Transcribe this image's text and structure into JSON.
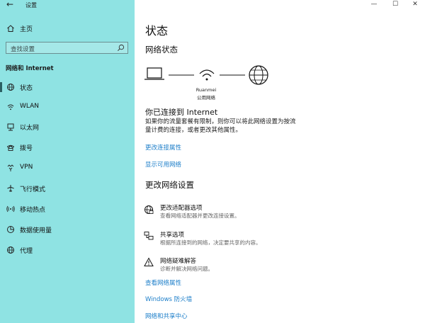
{
  "window": {
    "title": "设置",
    "back_icon": "←",
    "minimize_icon": "—",
    "maximize_icon": "☐",
    "close_icon": "✕"
  },
  "sidebar": {
    "home_label": "主页",
    "search_placeholder": "查找设置",
    "section_title": "网络和 Internet",
    "items": [
      {
        "label": "状态",
        "icon": "globe-icon"
      },
      {
        "label": "WLAN",
        "icon": "wifi-icon"
      },
      {
        "label": "以太网",
        "icon": "ethernet-icon"
      },
      {
        "label": "拨号",
        "icon": "dialup-icon"
      },
      {
        "label": "VPN",
        "icon": "vpn-icon"
      },
      {
        "label": "飞行模式",
        "icon": "airplane-icon"
      },
      {
        "label": "移动热点",
        "icon": "hotspot-icon"
      },
      {
        "label": "数据使用量",
        "icon": "data-usage-icon"
      },
      {
        "label": "代理",
        "icon": "globe-icon"
      }
    ],
    "active_index": 0
  },
  "main": {
    "title": "状态",
    "network_status_heading": "网络状态",
    "network_name": "Ruanmei",
    "network_type": "公用网络",
    "connected_heading": "你已连接到 Internet",
    "connected_desc": "如果你的流量套餐有限制，则你可以将此网络设置为按流量计费的连接，或者更改其他属性。",
    "links": {
      "change_props": "更改连接属性",
      "show_networks": "显示可用网络"
    },
    "change_settings_heading": "更改网络设置",
    "options": [
      {
        "title": "更改适配器选项",
        "desc": "查看网络适配器并更改连接设置。",
        "icon": "adapter-icon"
      },
      {
        "title": "共享选项",
        "desc": "根据所连接到的网络，决定要共享的内容。",
        "icon": "sharing-icon"
      },
      {
        "title": "网络疑难解答",
        "desc": "诊断并解决网络问题。",
        "icon": "warning-icon"
      }
    ],
    "bottom_links": {
      "view_properties": "查看网络属性",
      "firewall": "Windows 防火墙",
      "sharing_center": "网络和共享中心"
    }
  },
  "colors": {
    "sidebar_bg": "#8fe3e3",
    "link": "#1c7ec9"
  }
}
